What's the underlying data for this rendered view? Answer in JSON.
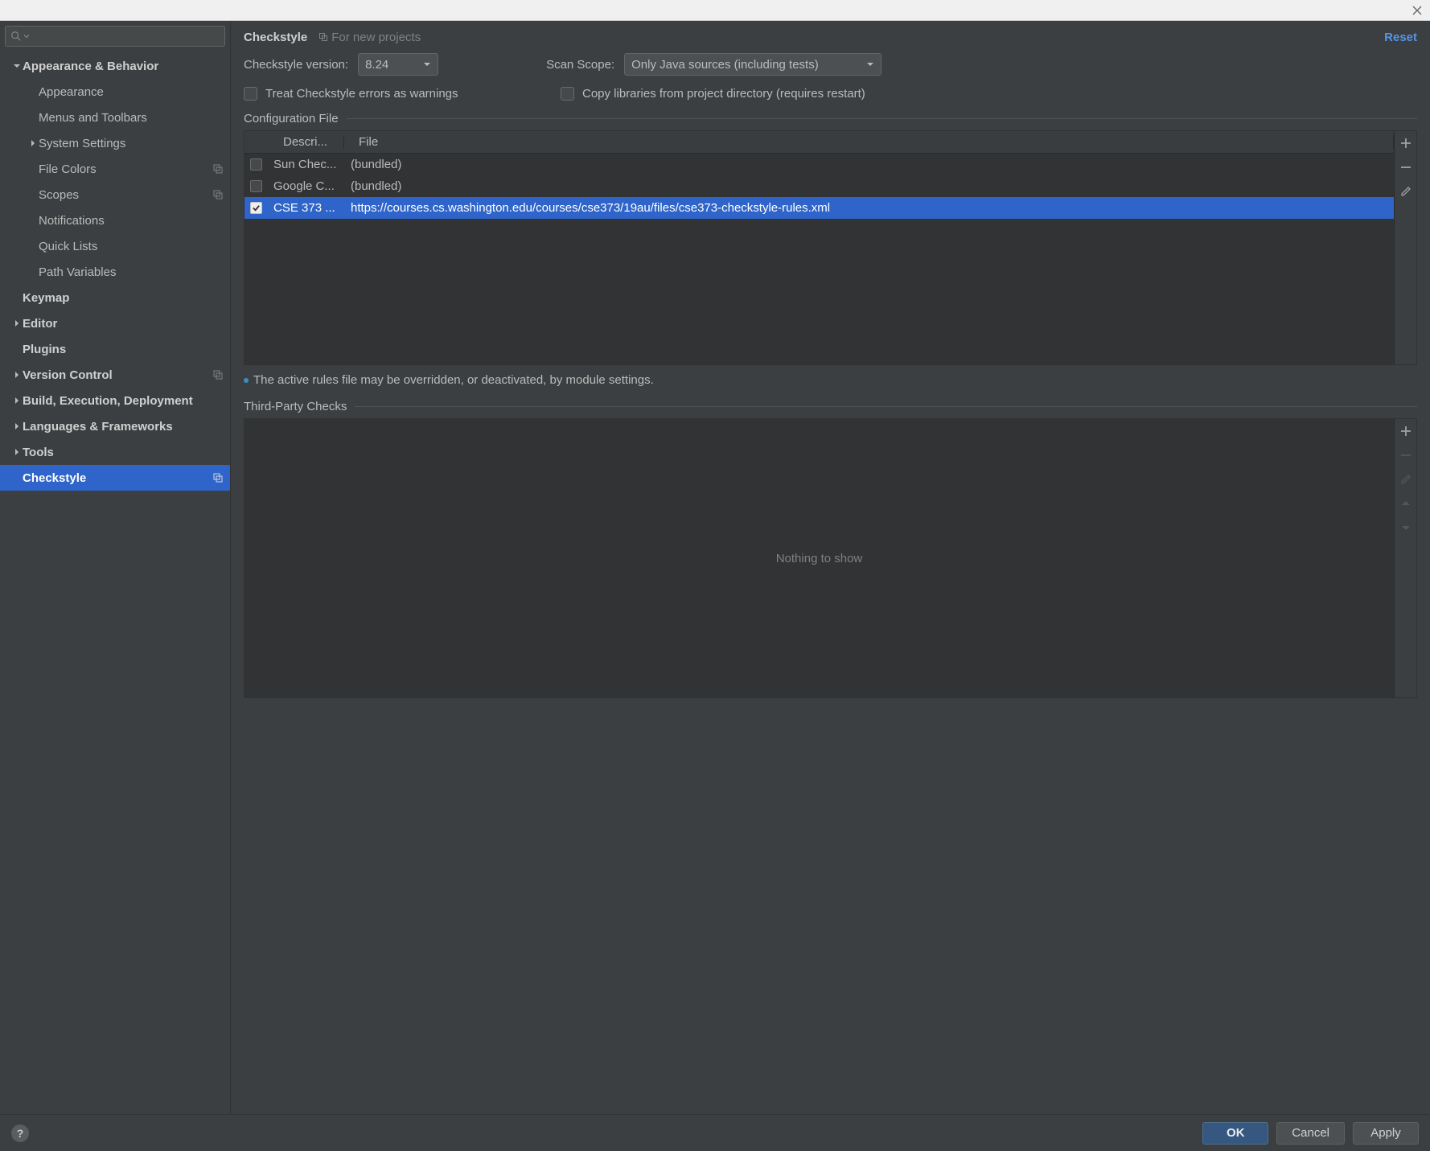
{
  "breadcrumb": {
    "title": "Checkstyle",
    "subtitle": "For new projects",
    "reset": "Reset"
  },
  "search": {
    "placeholder": ""
  },
  "sidebar": {
    "items": [
      {
        "label": "Appearance & Behavior",
        "depth": 0,
        "twisty": "down",
        "bold": true,
        "copy": false
      },
      {
        "label": "Appearance",
        "depth": 1,
        "twisty": "none",
        "bold": false,
        "copy": false
      },
      {
        "label": "Menus and Toolbars",
        "depth": 1,
        "twisty": "none",
        "bold": false,
        "copy": false
      },
      {
        "label": "System Settings",
        "depth": 1,
        "twisty": "right",
        "bold": false,
        "copy": false
      },
      {
        "label": "File Colors",
        "depth": 1,
        "twisty": "none",
        "bold": false,
        "copy": true
      },
      {
        "label": "Scopes",
        "depth": 1,
        "twisty": "none",
        "bold": false,
        "copy": true
      },
      {
        "label": "Notifications",
        "depth": 1,
        "twisty": "none",
        "bold": false,
        "copy": false
      },
      {
        "label": "Quick Lists",
        "depth": 1,
        "twisty": "none",
        "bold": false,
        "copy": false
      },
      {
        "label": "Path Variables",
        "depth": 1,
        "twisty": "none",
        "bold": false,
        "copy": false
      },
      {
        "label": "Keymap",
        "depth": 0,
        "twisty": "blank",
        "bold": true,
        "copy": false
      },
      {
        "label": "Editor",
        "depth": 0,
        "twisty": "right",
        "bold": true,
        "copy": false
      },
      {
        "label": "Plugins",
        "depth": 0,
        "twisty": "blank",
        "bold": true,
        "copy": false
      },
      {
        "label": "Version Control",
        "depth": 0,
        "twisty": "right",
        "bold": true,
        "copy": true
      },
      {
        "label": "Build, Execution, Deployment",
        "depth": 0,
        "twisty": "right",
        "bold": true,
        "copy": false
      },
      {
        "label": "Languages & Frameworks",
        "depth": 0,
        "twisty": "right",
        "bold": true,
        "copy": false
      },
      {
        "label": "Tools",
        "depth": 0,
        "twisty": "right",
        "bold": true,
        "copy": false
      },
      {
        "label": "Checkstyle",
        "depth": 0,
        "twisty": "blank",
        "bold": true,
        "copy": true,
        "selected": true
      }
    ]
  },
  "form": {
    "version_label": "Checkstyle version:",
    "version_value": "8.24",
    "scope_label": "Scan Scope:",
    "scope_value": "Only Java sources (including tests)",
    "treat_warnings_label": "Treat Checkstyle errors as warnings",
    "copy_libs_label": "Copy libraries from project directory (requires restart)",
    "config_section": "Configuration File",
    "columns": {
      "active": "",
      "description": "Descri...",
      "file": "File"
    },
    "rows": [
      {
        "checked": false,
        "description": "Sun Chec...",
        "file": "(bundled)",
        "selected": false
      },
      {
        "checked": false,
        "description": "Google C...",
        "file": "(bundled)",
        "selected": false
      },
      {
        "checked": true,
        "description": "CSE 373 ...",
        "file": "https://courses.cs.washington.edu/courses/cse373/19au/files/cse373-checkstyle-rules.xml",
        "selected": true
      }
    ],
    "note": "The active rules file may be overridden, or deactivated, by module settings.",
    "third_section": "Third-Party Checks",
    "third_empty": "Nothing to show"
  },
  "footer": {
    "ok": "OK",
    "cancel": "Cancel",
    "apply": "Apply"
  }
}
